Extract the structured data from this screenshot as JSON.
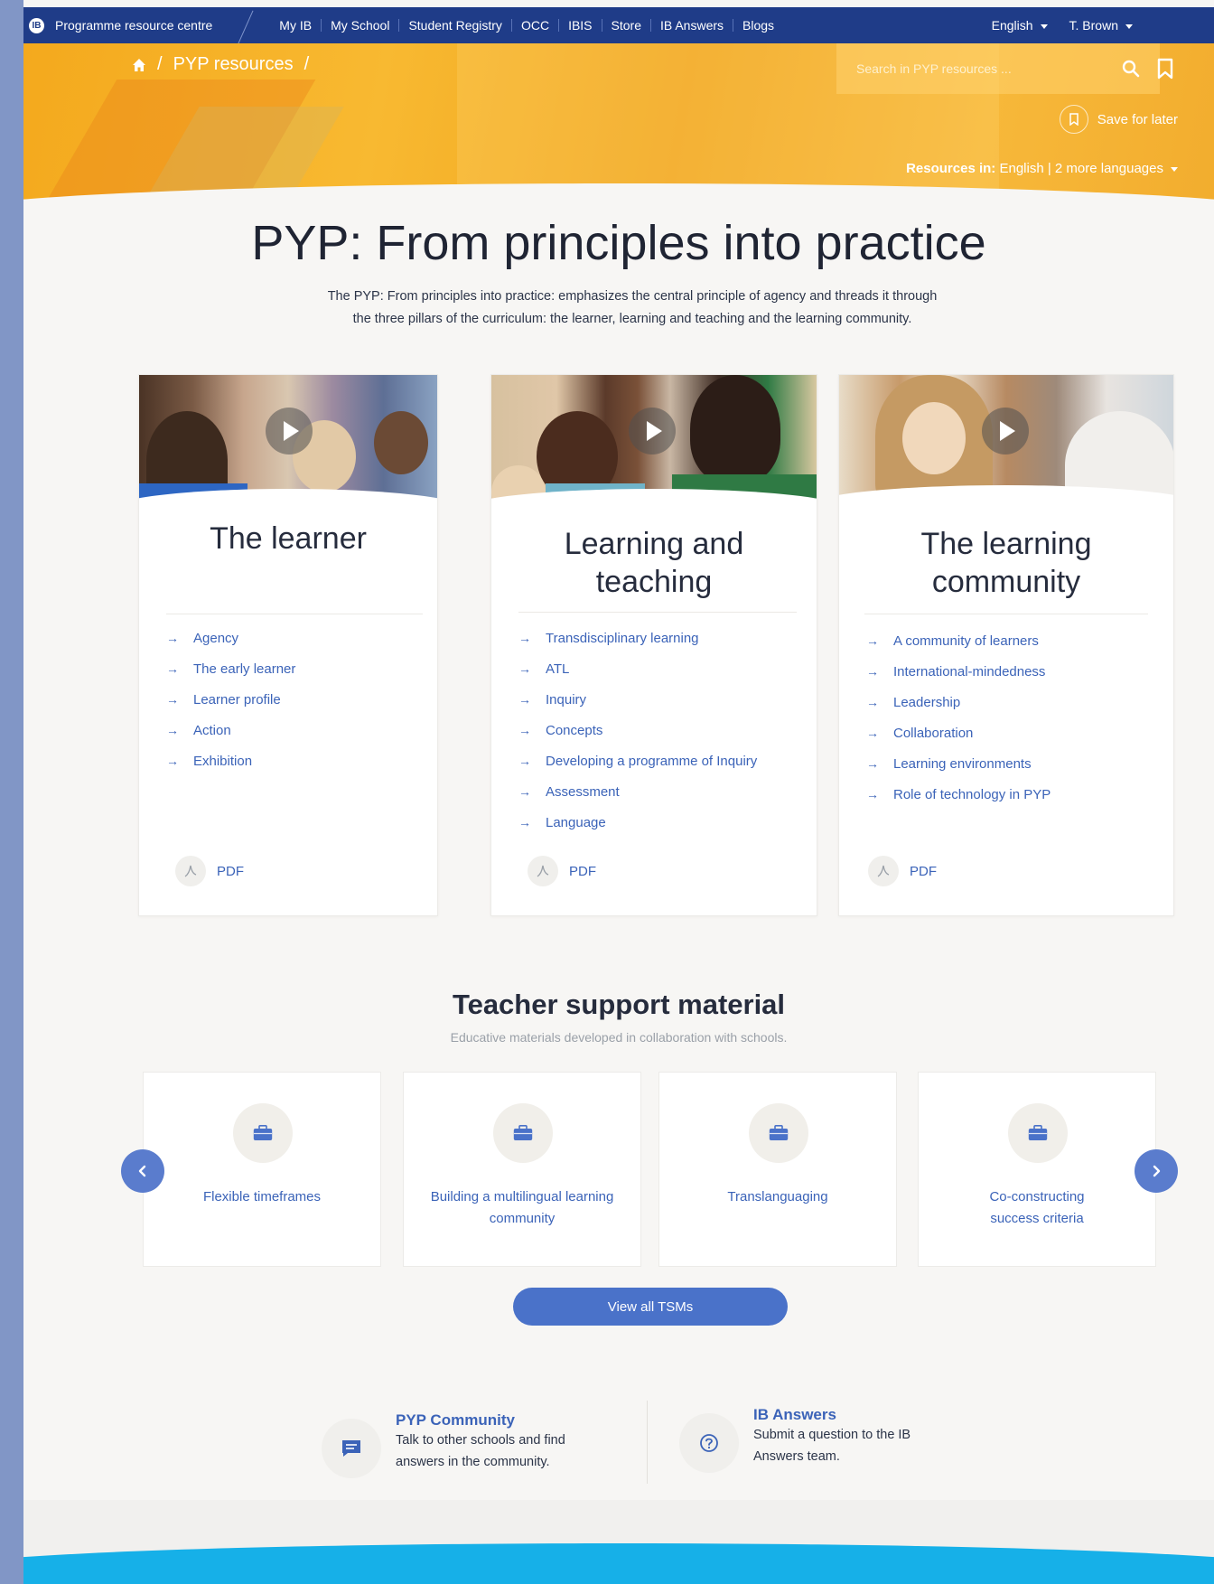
{
  "topnav": {
    "brand": "Programme resource centre",
    "links": [
      "My IB",
      "My School",
      "Student Registry",
      "OCC",
      "IBIS",
      "Store",
      "IB Answers",
      "Blogs"
    ],
    "language": "English",
    "user": "T. Brown"
  },
  "hero": {
    "breadcrumb": "PYP resources",
    "search_placeholder": "Search in PYP  resources ...",
    "save_label": "Save for later",
    "resources_label": "Resources in:",
    "current_language": "English |",
    "more_languages": "2 more languages"
  },
  "main": {
    "title": "PYP: From principles into practice",
    "intro": "The PYP: From principles into practice: emphasizes the central principle of agency and threads it through the three pillars of the curriculum:  the learner, learning and teaching and the learning community."
  },
  "cards": [
    {
      "title": "The learner",
      "links": [
        "Agency",
        "The early learner",
        "Learner profile",
        "Action",
        "Exhibition"
      ],
      "pdf": "PDF"
    },
    {
      "title_line1": "Learning and",
      "title_line2": "teaching",
      "links": [
        "Transdisciplinary learning",
        "ATL",
        "Inquiry",
        "Concepts",
        "Developing a programme of Inquiry",
        "Assessment",
        "Language"
      ],
      "pdf": "PDF"
    },
    {
      "title_line1": "The learning",
      "title_line2": "community",
      "links": [
        "A community of learners",
        "International-mindedness",
        "Leadership",
        "Collaboration",
        "Learning environments",
        "Role of technology in PYP"
      ],
      "pdf": "PDF"
    }
  ],
  "tsm": {
    "title": "Teacher support material",
    "subtitle": "Educative materials developed in collaboration with schools.",
    "items": [
      {
        "line1": "Flexible timeframes",
        "line2": ""
      },
      {
        "line1": "Building a multilingual learning",
        "line2": "community"
      },
      {
        "line1": "Translanguaging",
        "line2": ""
      },
      {
        "line1": "Co-constructing",
        "line2": "success criteria"
      }
    ],
    "view_all": "View all TSMs"
  },
  "help": {
    "community_title": "PYP Community",
    "community_text": "Talk to other schools and find answers in the community.",
    "answers_title": "IB Answers",
    "answers_text": "Submit a question to the IB Answers team."
  },
  "colors": {
    "nav": "#1f3c88",
    "hero": "#f4a91d",
    "link": "#3b63b8",
    "button": "#4a72c9",
    "footer": "#16b0e8"
  },
  "icons": [
    "ib-logo-icon",
    "home-icon",
    "search-icon",
    "bookmark-icon",
    "play-icon",
    "arrow-right-icon",
    "pdf-icon",
    "briefcase-icon",
    "chevron-left-icon",
    "chevron-right-icon",
    "chat-icon",
    "question-icon"
  ]
}
